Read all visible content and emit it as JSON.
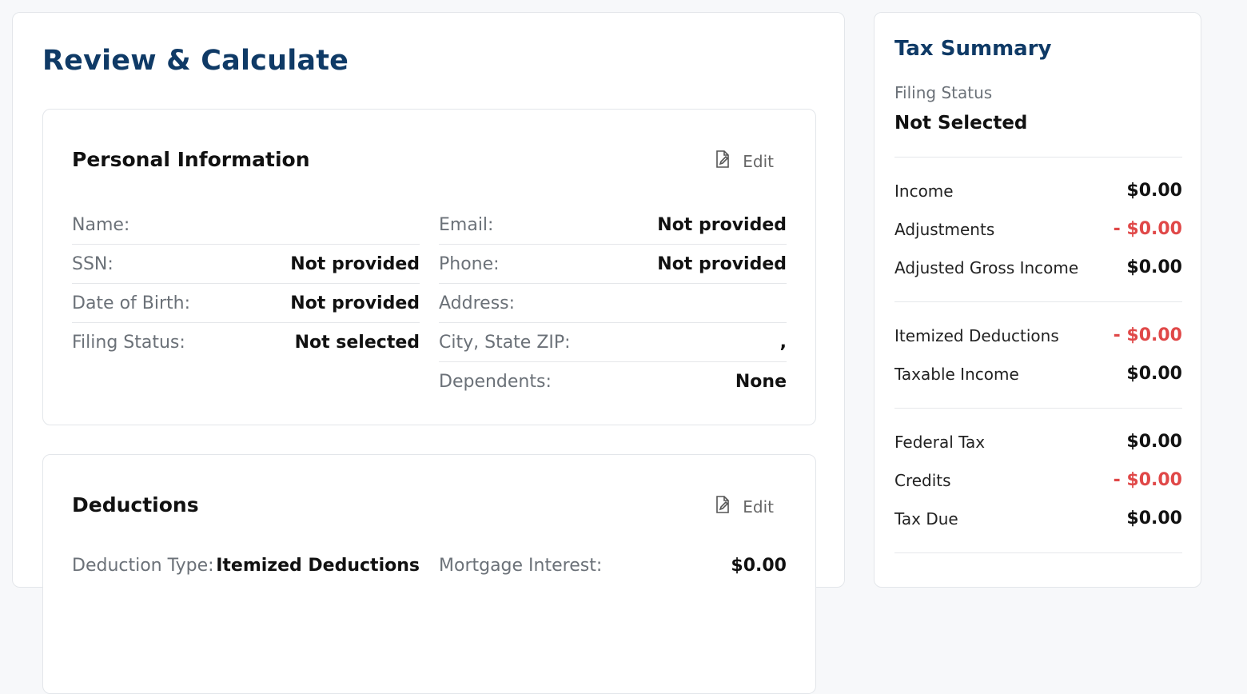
{
  "page": {
    "title": "Review & Calculate"
  },
  "personal": {
    "title": "Personal Information",
    "edit_label": "Edit",
    "left": [
      {
        "label": "Name:",
        "value": ""
      },
      {
        "label": "SSN:",
        "value": "Not provided"
      },
      {
        "label": "Date of Birth:",
        "value": "Not provided"
      },
      {
        "label": "Filing Status:",
        "value": "Not selected"
      }
    ],
    "right": [
      {
        "label": "Email:",
        "value": "Not provided"
      },
      {
        "label": "Phone:",
        "value": "Not provided"
      },
      {
        "label": "Address:",
        "value": ""
      },
      {
        "label": "City, State ZIP:",
        "value": ","
      },
      {
        "label": "Dependents:",
        "value": "None"
      }
    ]
  },
  "deductions": {
    "title": "Deductions",
    "edit_label": "Edit",
    "left": [
      {
        "label": "Deduction Type:",
        "value": "Itemized Deductions"
      }
    ],
    "right": [
      {
        "label": "Mortgage Interest:",
        "value": "$0.00"
      }
    ]
  },
  "summary": {
    "title": "Tax Summary",
    "filing_status_label": "Filing Status",
    "filing_status_value": "Not Selected",
    "rows": [
      {
        "label": "Income",
        "value": "$0.00",
        "negative": false
      },
      {
        "label": "Adjustments",
        "value": "- $0.00",
        "negative": true
      },
      {
        "label": "Adjusted Gross Income",
        "value": "$0.00",
        "negative": false
      },
      {
        "label": "Itemized Deductions",
        "value": "- $0.00",
        "negative": true
      },
      {
        "label": "Taxable Income",
        "value": "$0.00",
        "negative": false
      },
      {
        "label": "Federal Tax",
        "value": "$0.00",
        "negative": false
      },
      {
        "label": "Credits",
        "value": "- $0.00",
        "negative": true
      },
      {
        "label": "Tax Due",
        "value": "$0.00",
        "negative": false
      }
    ]
  },
  "colors": {
    "title": "#0f3a66",
    "negative": "#e04848",
    "label": "#6b7178"
  }
}
